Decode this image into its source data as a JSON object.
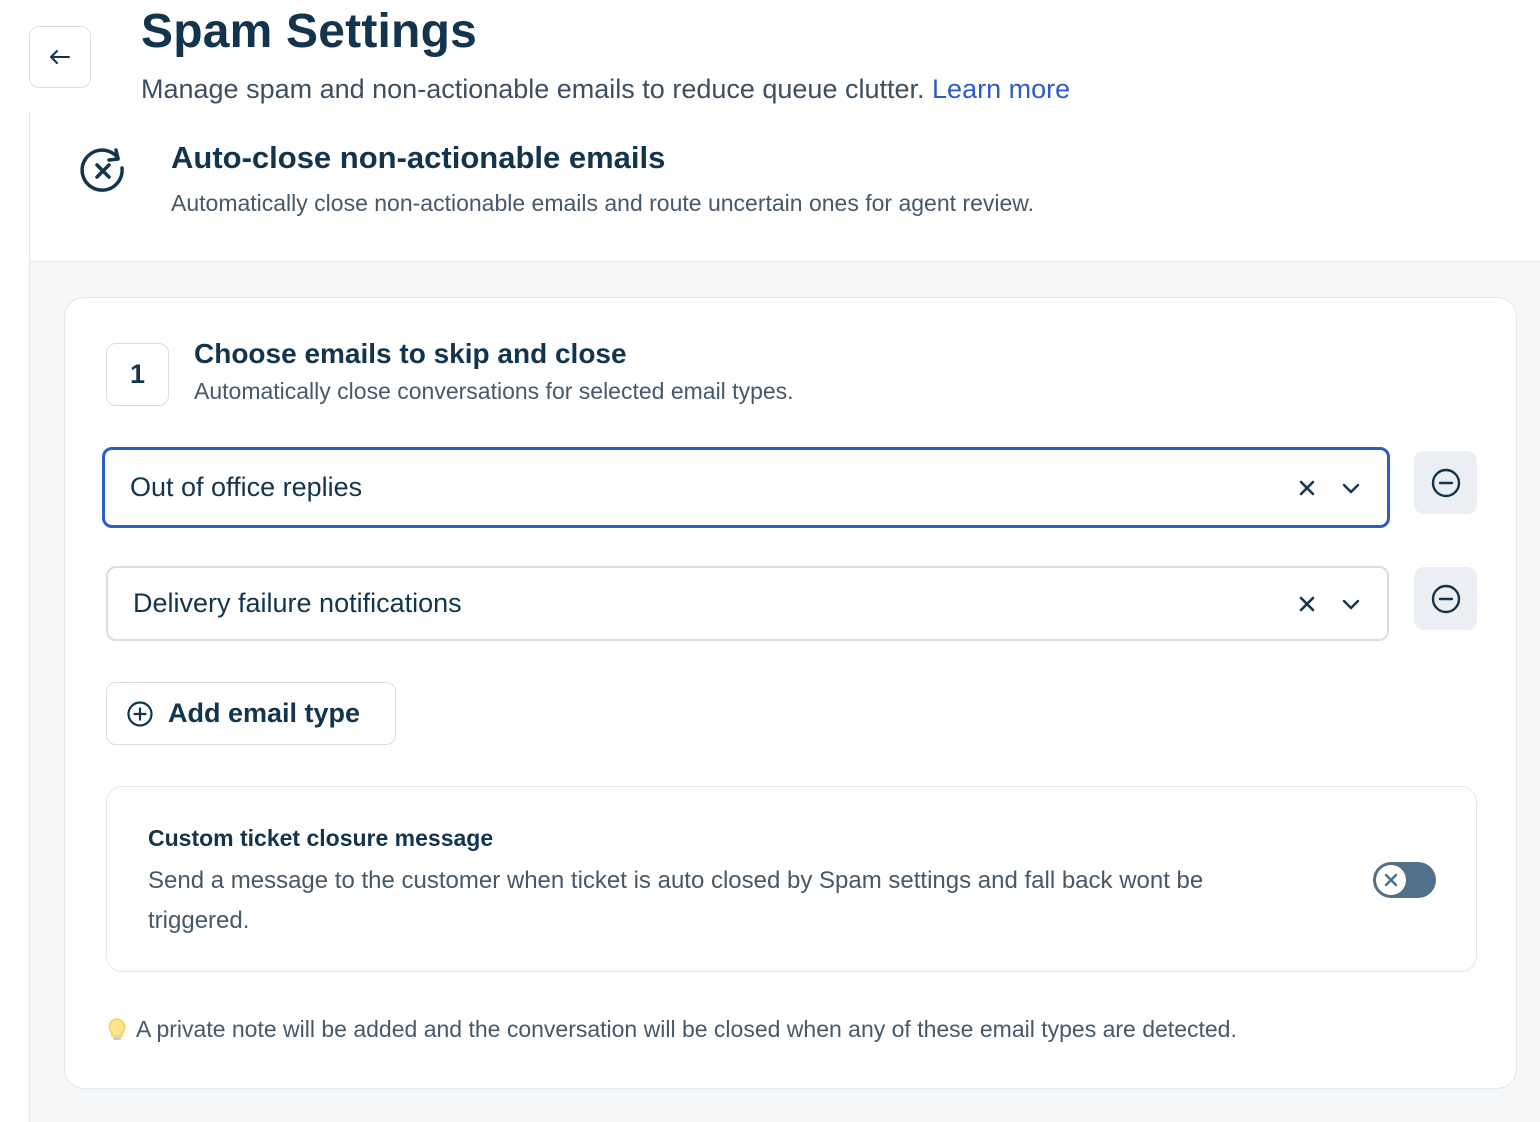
{
  "header": {
    "title": "Spam Settings",
    "subtitle": "Manage spam and non-actionable emails to reduce queue clutter.",
    "learn_more": "Learn more"
  },
  "section": {
    "title": "Auto-close non-actionable emails",
    "description": "Automatically close non-actionable emails and route uncertain ones for agent review."
  },
  "step": {
    "number": "1",
    "title": "Choose emails to skip and close",
    "description": "Automatically close conversations for selected email types."
  },
  "email_types": [
    {
      "value": "Out of office replies",
      "focused": true
    },
    {
      "value": "Delivery failure notifications",
      "focused": false
    }
  ],
  "add_button_label": "Add email type",
  "closure": {
    "title": "Custom ticket closure message",
    "description": "Send a message to the customer when ticket is auto closed by Spam settings and fall back wont be triggered.",
    "enabled": false
  },
  "note": "A private note will be added and the conversation will be closed when any of these email types are detected.",
  "colors": {
    "primary_text": "#12344d",
    "link": "#2c5cc5",
    "focus_border": "#2c5cc5",
    "toggle_off": "#527089"
  },
  "icons": {
    "back": "arrow-left-icon",
    "section": "auto-close-icon",
    "clear": "close-icon",
    "chevron": "chevron-down-icon",
    "remove": "minus-circle-icon",
    "add": "plus-circle-icon",
    "note": "lightbulb-icon"
  }
}
